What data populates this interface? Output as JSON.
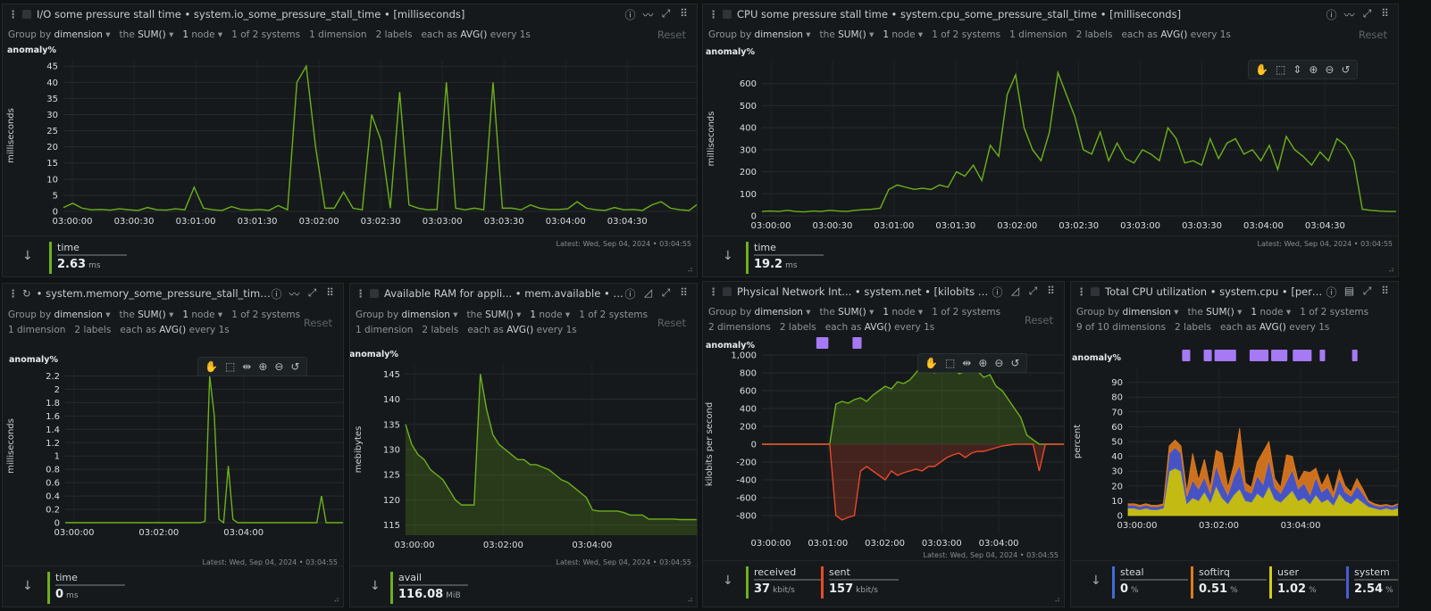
{
  "common": {
    "groupby_prefix": "Group by",
    "groupby": "dimension",
    "the": "the",
    "agg": "SUM()",
    "node": "1",
    "node_label": "node",
    "systems": "1 of 2 systems",
    "labels": "2 labels",
    "each": "each as",
    "avg": "AVG()",
    "every": "every 1s",
    "reset": "Reset",
    "latest": "Latest:  Wed, Sep 04, 2024 • 03:04:55",
    "anomaly": "anomaly%"
  },
  "colors": {
    "green": "#6cb01c",
    "red": "#e8492a",
    "purple": "#a57af4",
    "orange": "#e07a1f",
    "yellow": "#d6cc14",
    "blue": "#4b5bd6",
    "steal_blue": "#3c6fd8"
  },
  "icons": [
    "kebab-menu-icon",
    "chart-type-icon",
    "expand-icon",
    "drag-handle-icon",
    "pan-icon",
    "select-icon",
    "zoom-in-icon",
    "zoom-out-icon",
    "reset-zoom-icon",
    "down-arrow-icon",
    "resize-grip-icon"
  ],
  "p1": {
    "title": "I/O some pressure stall time • system.io_some_pressure_stall_time • [milliseconds]",
    "dims": "1 dimension",
    "ylabel": "milliseconds",
    "legend": {
      "name": "time",
      "value": "2.63",
      "unit": "ms"
    }
  },
  "p2": {
    "title": "CPU some pressure stall time • system.cpu_some_pressure_stall_time • [milliseconds]",
    "dims": "1 dimension",
    "ylabel": "milliseconds",
    "legend": {
      "name": "time",
      "value": "19.2",
      "unit": "ms"
    }
  },
  "p3": {
    "title": "• system.memory_some_pressure_stall_time • [millise",
    "dims": "1 dimension",
    "ylabel": "milliseconds",
    "legend": {
      "name": "time",
      "value": "0",
      "unit": "ms"
    }
  },
  "p4": {
    "title": "Available RAM for appli... • mem.available • [mebibytes]",
    "dims": "1 dimension",
    "ylabel": "mebibytes",
    "legend": {
      "name": "avail",
      "value": "116.08",
      "unit": "MiB"
    }
  },
  "p5": {
    "title": "Physical Network Int... • system.net • [kilobits per second]",
    "dims": "2 dimensions",
    "ylabel": "kilobits per second",
    "legend": [
      {
        "name": "received",
        "value": "37",
        "unit": "kbit/s"
      },
      {
        "name": "sent",
        "value": "157",
        "unit": "kbit/s"
      }
    ]
  },
  "p6": {
    "title": "Total CPU utilization • system.cpu • [percent]",
    "dims": "9 of 10 dimensions",
    "ylabel": "percent",
    "legend": [
      {
        "name": "steal",
        "value": "0",
        "unit": "%"
      },
      {
        "name": "softirq",
        "value": "0.51",
        "unit": "%"
      },
      {
        "name": "user",
        "value": "1.02",
        "unit": "%"
      },
      {
        "name": "system",
        "value": "2.54",
        "unit": "%"
      }
    ]
  },
  "chart_data": [
    {
      "id": "p1",
      "type": "line",
      "ylabel": "milliseconds",
      "ylim": [
        0,
        47
      ],
      "yticks": [
        0,
        5,
        10,
        15,
        20,
        25,
        30,
        35,
        40,
        45
      ],
      "xticks": [
        "03:00:00",
        "03:00:30",
        "03:01:00",
        "03:01:30",
        "03:02:00",
        "03:02:30",
        "03:03:00",
        "03:03:30",
        "03:04:00",
        "03:04:30"
      ],
      "x_start": "03:00:00",
      "x_end": "03:04:55",
      "series": [
        {
          "values": [
            1.2,
            2.5,
            1,
            0.5,
            0.6,
            0.4,
            0.8,
            0.5,
            0.3,
            1.2,
            0.5,
            0.4,
            0.8,
            0.5,
            7.5,
            1,
            0.5,
            0.3,
            1.5,
            0.6,
            0.4,
            0.6,
            0.3,
            1.8,
            0.5,
            40,
            45,
            20,
            1,
            1,
            6,
            1,
            0.5,
            30,
            22,
            1,
            37,
            2,
            1,
            0.5,
            0.6,
            40,
            1,
            0.5,
            1,
            0.5,
            40,
            1,
            1,
            0.5,
            2,
            1,
            0.6,
            0.6,
            0.8,
            3,
            1,
            0.5,
            0.3,
            1.2,
            0.5,
            0.6,
            0.3,
            2,
            3,
            1,
            0.5,
            0.3,
            2.5
          ]
        }
      ]
    },
    {
      "id": "p2",
      "type": "line",
      "ylabel": "milliseconds",
      "ylim": [
        0,
        700
      ],
      "yticks": [
        0,
        100,
        200,
        300,
        400,
        500,
        600
      ],
      "xticks": [
        "03:00:00",
        "03:00:30",
        "03:01:00",
        "03:01:30",
        "03:02:00",
        "03:02:30",
        "03:03:00",
        "03:03:30",
        "03:04:00",
        "03:04:30"
      ],
      "x_start": "03:00:00",
      "x_end": "03:04:55",
      "series": [
        {
          "values": [
            20,
            22,
            20,
            25,
            20,
            18,
            22,
            20,
            25,
            22,
            20,
            25,
            28,
            30,
            35,
            120,
            140,
            130,
            120,
            125,
            120,
            140,
            130,
            200,
            180,
            230,
            160,
            320,
            270,
            550,
            640,
            400,
            300,
            250,
            380,
            650,
            550,
            450,
            300,
            280,
            380,
            250,
            330,
            260,
            240,
            300,
            280,
            250,
            400,
            350,
            240,
            250,
            230,
            350,
            260,
            330,
            350,
            280,
            300,
            250,
            320,
            210,
            360,
            300,
            270,
            230,
            290,
            250,
            350,
            320,
            250,
            30,
            25,
            22,
            20,
            20
          ]
        }
      ]
    },
    {
      "id": "p3",
      "type": "line",
      "ylabel": "milliseconds",
      "ylim": [
        0,
        2.3
      ],
      "yticks": [
        0,
        0.2,
        0.4,
        0.6,
        0.8,
        1,
        1.2,
        1.4,
        1.6,
        1.8,
        2,
        2.2
      ],
      "xticks": [
        "03:00:00",
        "03:02:00",
        "03:04:00"
      ],
      "x_start": "03:00:00",
      "x_end": "03:04:55",
      "series": [
        {
          "values": [
            0,
            0,
            0,
            0,
            0,
            0,
            0,
            0,
            0,
            0,
            0,
            0,
            0,
            0,
            0,
            0,
            0,
            0,
            0,
            0,
            0,
            0,
            0,
            0,
            0,
            0,
            0,
            0,
            0,
            0,
            0.02,
            2.2,
            1.6,
            0.05,
            0,
            0.85,
            0.05,
            0,
            0,
            0,
            0,
            0,
            0,
            0,
            0,
            0,
            0,
            0,
            0,
            0,
            0,
            0,
            0,
            0,
            0,
            0.4,
            0,
            0,
            0,
            0,
            0
          ]
        }
      ]
    },
    {
      "id": "p4",
      "type": "area",
      "ylabel": "mebibytes",
      "ylim": [
        113,
        147
      ],
      "yticks": [
        115,
        120,
        125,
        130,
        135,
        140,
        145
      ],
      "xticks": [
        "03:00:00",
        "03:02:00",
        "03:04:00"
      ],
      "x_start": "03:00:00",
      "x_end": "03:04:55",
      "series": [
        {
          "values": [
            135,
            131,
            129,
            128,
            126,
            125,
            124,
            122,
            120,
            119,
            119,
            119,
            145,
            138,
            133,
            131,
            130,
            129,
            128,
            128,
            127,
            127,
            126.5,
            126,
            125,
            124,
            123.5,
            122.5,
            121.5,
            120.5,
            118,
            117.8,
            117.8,
            117.8,
            117.8,
            117.5,
            117,
            117,
            117,
            116.2,
            116.2,
            116.2,
            116.2,
            116.2,
            116.1,
            116.1,
            116.1,
            116.08
          ]
        }
      ]
    },
    {
      "id": "p5",
      "type": "area",
      "ylabel": "kilobits per second",
      "ylim": [
        -1000,
        1000
      ],
      "yticks": [
        -800,
        -600,
        -400,
        -200,
        0,
        200,
        400,
        600,
        800,
        1000
      ],
      "xticks": [
        "03:00:00",
        "03:01:00",
        "03:02:00",
        "03:03:00",
        "03:04:00"
      ],
      "x_start": "03:00:00",
      "x_end": "03:04:55",
      "series": [
        {
          "name": "received",
          "values": [
            0,
            0,
            0,
            0,
            0,
            0,
            0,
            0,
            0,
            0,
            0,
            0,
            450,
            480,
            460,
            500,
            520,
            480,
            550,
            600,
            650,
            620,
            700,
            680,
            720,
            800,
            900,
            850,
            800,
            880,
            830,
            860,
            790,
            820,
            900,
            820,
            750,
            780,
            650,
            600,
            500,
            400,
            300,
            100,
            50,
            0,
            0,
            0,
            0,
            0
          ]
        },
        {
          "name": "sent",
          "values": [
            0,
            0,
            0,
            0,
            0,
            0,
            0,
            0,
            0,
            0,
            0,
            0,
            -800,
            -850,
            -820,
            -800,
            -300,
            -250,
            -300,
            -350,
            -400,
            -300,
            -350,
            -320,
            -300,
            -280,
            -300,
            -250,
            -250,
            -200,
            -150,
            -120,
            -100,
            -150,
            -100,
            -80,
            -80,
            -60,
            -40,
            -20,
            -10,
            0,
            0,
            0,
            0,
            -300,
            0,
            0,
            0,
            0
          ]
        }
      ],
      "annotation_bands": [
        [
          0.18,
          0.22
        ],
        [
          0.3,
          0.33
        ]
      ]
    },
    {
      "id": "p6",
      "type": "area",
      "ylabel": "percent",
      "ylim": [
        0,
        100
      ],
      "yticks": [
        0,
        10,
        20,
        30,
        40,
        50,
        60,
        70,
        80,
        90
      ],
      "xticks": [
        "03:00:00",
        "03:02:00",
        "03:04:00"
      ],
      "x_start": "03:00:00",
      "x_end": "03:04:55",
      "series": [
        {
          "name": "user",
          "values": [
            5,
            5,
            4,
            5,
            4,
            4,
            5,
            30,
            32,
            30,
            8,
            12,
            10,
            16,
            9,
            20,
            12,
            8,
            14,
            18,
            10,
            9,
            15,
            12,
            20,
            11,
            9,
            13,
            17,
            10,
            12,
            8,
            14,
            9,
            11,
            7,
            15,
            10,
            8,
            12,
            9,
            6,
            5,
            4,
            5,
            4,
            5
          ]
        },
        {
          "name": "system",
          "values": [
            2,
            2,
            2,
            2,
            2,
            2,
            2,
            12,
            14,
            12,
            5,
            12,
            8,
            10,
            6,
            14,
            10,
            6,
            12,
            16,
            7,
            6,
            12,
            9,
            18,
            8,
            6,
            10,
            14,
            8,
            10,
            6,
            12,
            7,
            8,
            5,
            10,
            6,
            5,
            8,
            6,
            3,
            2,
            2,
            2,
            2,
            2.54
          ]
        },
        {
          "name": "softirq",
          "values": [
            1,
            1,
            1,
            1,
            1,
            1,
            1,
            5,
            5,
            5,
            3,
            18,
            6,
            12,
            4,
            10,
            20,
            5,
            8,
            25,
            5,
            4,
            9,
            22,
            12,
            6,
            4,
            18,
            9,
            5,
            8,
            15,
            6,
            4,
            9,
            3,
            6,
            4,
            3,
            5,
            3,
            1,
            1,
            1,
            0.5,
            0.5,
            0.51
          ]
        }
      ],
      "annotation_bands": [
        [
          0.2,
          0.23
        ],
        [
          0.28,
          0.31
        ],
        [
          0.32,
          0.4
        ],
        [
          0.45,
          0.52
        ],
        [
          0.53,
          0.59
        ],
        [
          0.61,
          0.68
        ],
        [
          0.71,
          0.73
        ],
        [
          0.83,
          0.85
        ]
      ]
    }
  ]
}
